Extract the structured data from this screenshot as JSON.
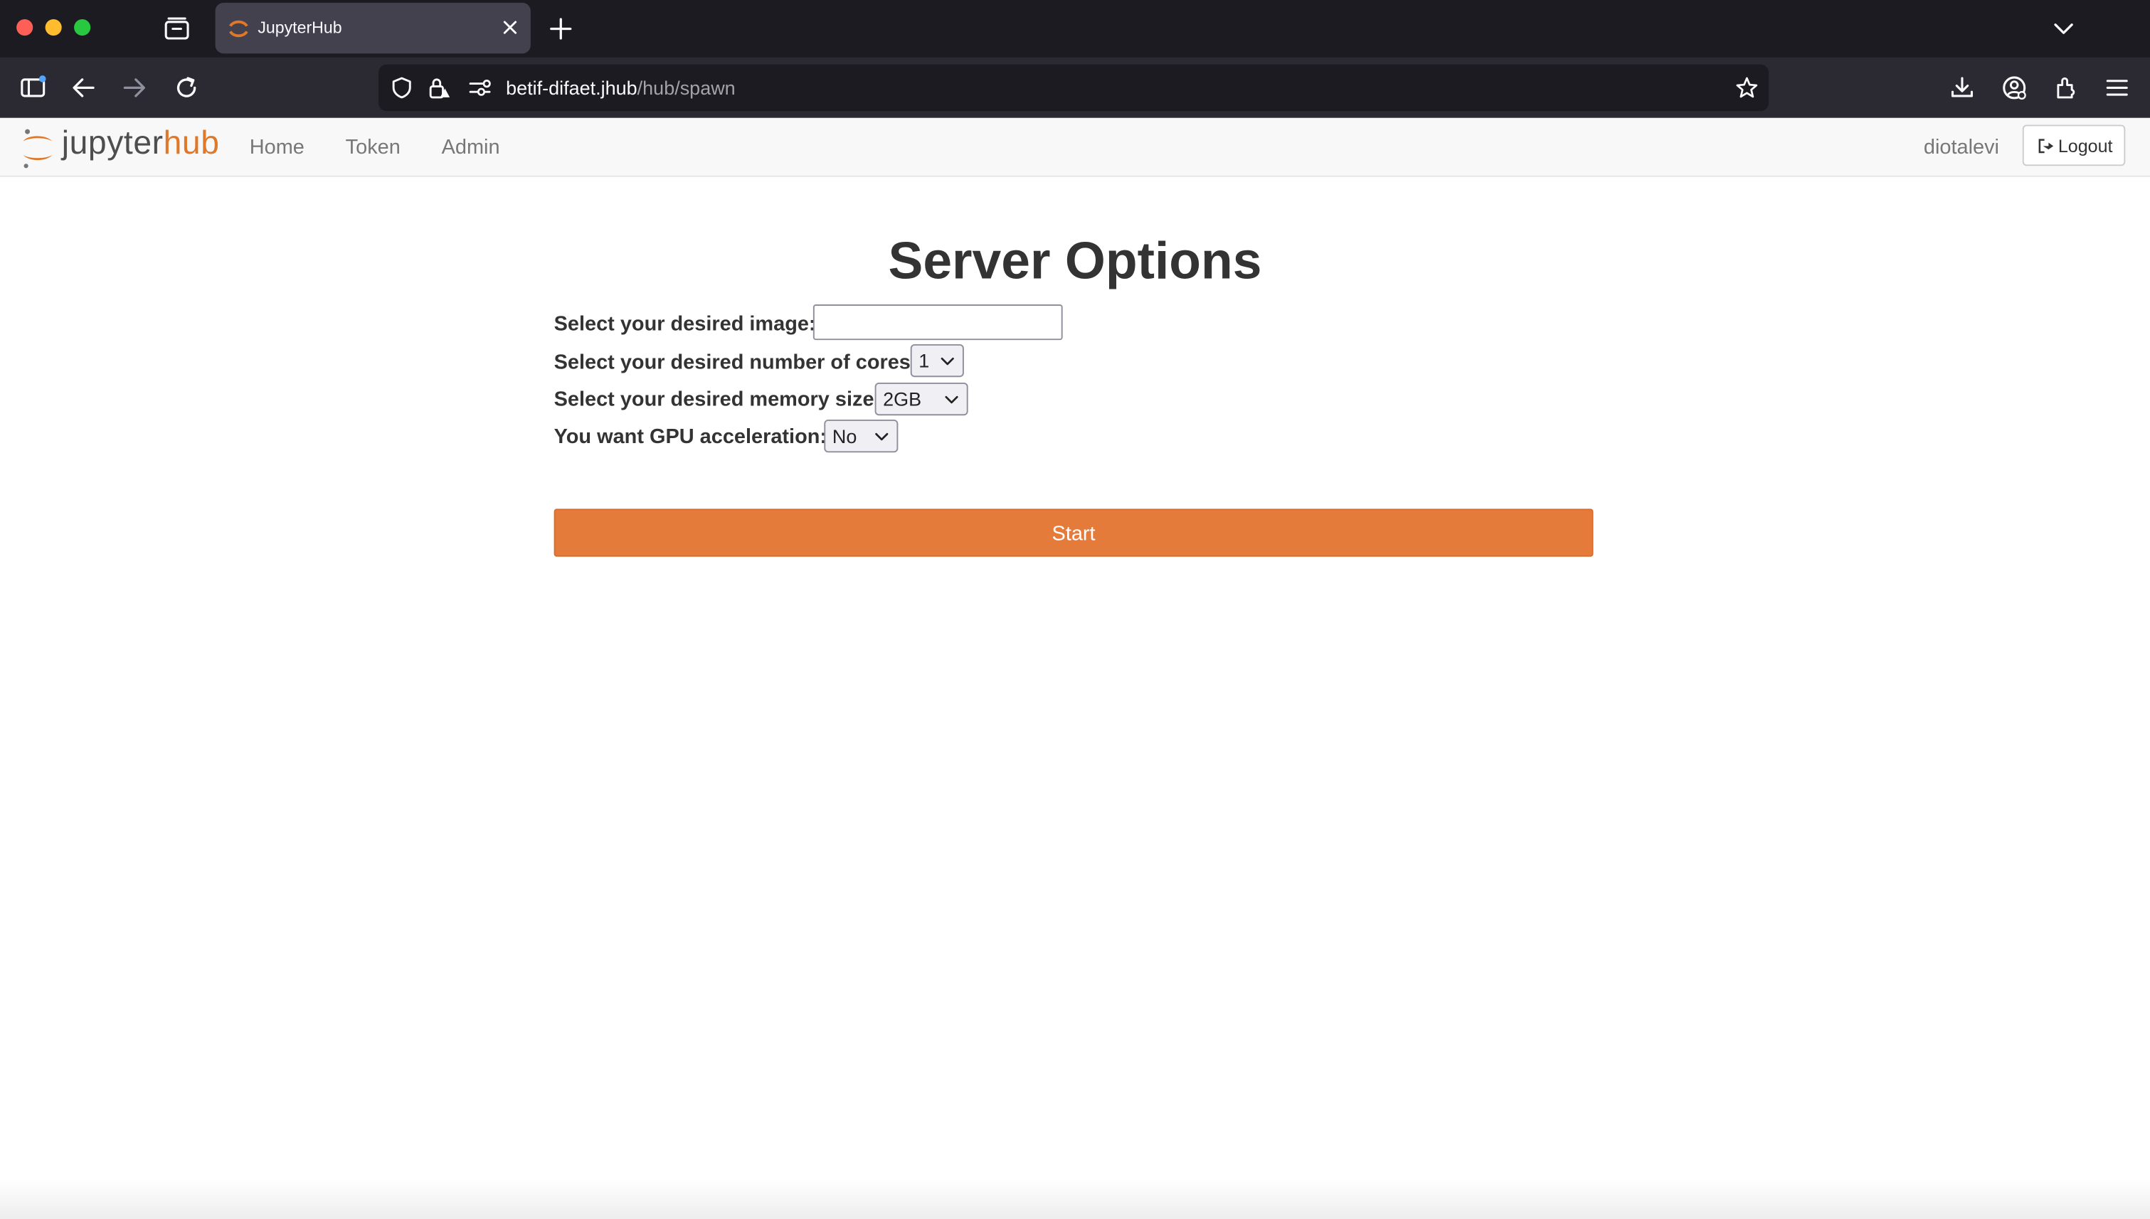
{
  "browser": {
    "tab_title": "JupyterHub",
    "url_domain": "betif-difaet.jhub",
    "url_path": "/hub/spawn"
  },
  "header": {
    "logo_jupyter": "jupyter",
    "logo_hub": "hub",
    "nav_items": [
      "Home",
      "Token",
      "Admin"
    ],
    "username": "diotalevi",
    "logout_label": "Logout"
  },
  "main": {
    "title": "Server Options",
    "image_label": "Select your desired image:",
    "image_value": "",
    "cores_label": "Select your desired number of cores:",
    "cores_value": "1",
    "memory_label": "Select your desired memory size:",
    "memory_value": "2GB",
    "gpu_label": "You want GPU acceleration:",
    "gpu_value": "No",
    "start_label": "Start"
  },
  "colors": {
    "brand_orange": "#e57b3a",
    "header_bg": "#f8f8f8"
  }
}
